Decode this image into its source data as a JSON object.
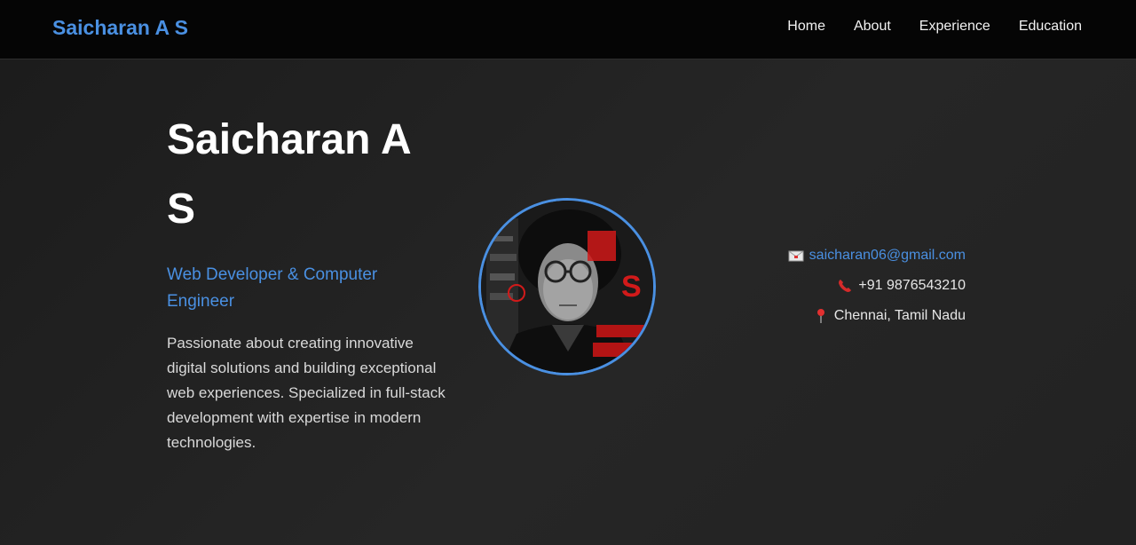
{
  "nav": {
    "brand": "Saicharan A S",
    "links": [
      "Home",
      "About",
      "Experience",
      "Education"
    ]
  },
  "hero": {
    "name": "Saicharan A S",
    "subtitle": "Web Developer & Computer Engineer",
    "description": "Passionate about creating innovative digital solutions and building exceptional web experiences. Specialized in full-stack development with expertise in modern technologies."
  },
  "contact": {
    "email": "saicharan06@gmail.com",
    "phone": "+91 9876543210",
    "location": "Chennai, Tamil Nadu",
    "email_icon": "envelope-icon",
    "phone_icon": "telephone-icon",
    "location_icon": "pin-icon"
  },
  "colors": {
    "accent": "#4a90e2",
    "navbar_bg": "#050505",
    "hero_bg": "#1e1e1e",
    "text": "#ffffff"
  }
}
